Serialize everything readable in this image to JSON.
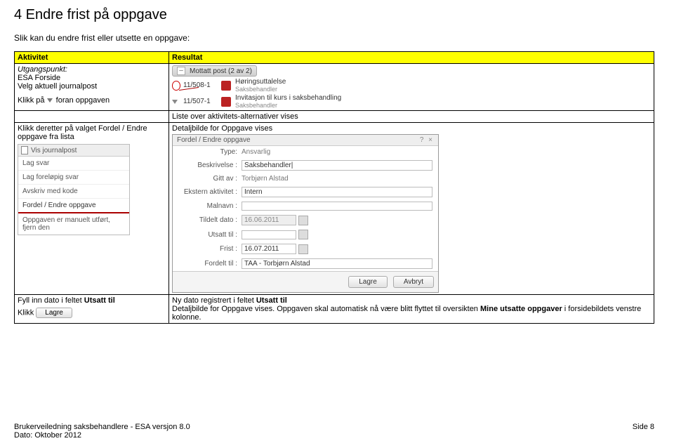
{
  "heading": "4    Endre frist på oppgave",
  "subheading": "Slik kan du endre frist eller utsette en oppgave:",
  "table": {
    "header_a": "Aktivitet",
    "header_b": "Resultat",
    "row1a_line1": "Utgangspunkt:",
    "row1a_line2": "ESA Forside",
    "row1a_line3": "Velg aktuell journalpost",
    "row1a_line5": "Klikk på ",
    "row1a_line5b": " foran oppgaven",
    "mottatt": "Mottatt post (2 av 2)",
    "jp": [
      {
        "id": "11/508-1",
        "title": "Høringsuttalelse",
        "sub": "Saksbehandler"
      },
      {
        "id": "11/507-1",
        "title": "Invitasjon til kurs i saksbehandling",
        "sub": "Saksbehandler"
      }
    ],
    "row2b": "Liste over aktivitets-alternativer vises",
    "row3a_line1": "Klikk deretter på valget Fordel / Endre",
    "row3a_line2": "oppgave fra lista",
    "row3b": "Detaljbilde for Oppgave vises",
    "menu": {
      "title": "Vis journalpost",
      "items": [
        "Lag svar",
        "Lag foreløpig svar",
        "Avskriv med kode"
      ],
      "highlight": "Fordel / Endre oppgave",
      "last": "Oppgaven er manuelt utført, fjern den"
    },
    "dialog": {
      "title": "Fordel / Endre oppgave",
      "fields": {
        "type": "Type:",
        "type_v": "Ansvarlig",
        "beskrivelse": "Beskrivelse :",
        "beskrivelse_v": "Saksbehandler|",
        "gitt": "Gitt av :",
        "gitt_v": "Torbjørn Alstad",
        "ekstern": "Ekstern aktivitet :",
        "ekstern_v": "Intern",
        "malnavn": "Malnavn :",
        "tildelt": "Tildelt dato :",
        "tildelt_v": "16.06.2011",
        "utsatt": "Utsatt til :",
        "frist": "Frist :",
        "frist_v": "16.07.2011",
        "fordelt": "Fordelt til :",
        "fordelt_v": "TAA - Torbjørn Alstad"
      },
      "lagre": "Lagre",
      "avbryt": "Avbryt"
    },
    "row4a_line1": "Fyll inn dato i feltet Utsatt til",
    "row4a_line2": "Klikk",
    "row4a_btn": "Lagre",
    "row4b_line1": "Ny dato registrert i feltet Utsatt til",
    "row4b_line2a": "Detaljbilde for Oppgave vises. Oppgaven skal automatisk nå være blitt flyttet til oversikten ",
    "row4b_line2b": "Mine utsatte oppgaver",
    "row4b_line2c": " i forsidebildets venstre kolonne."
  },
  "footer": {
    "left1": "Brukerveiledning saksbehandlere - ESA versjon 8.0",
    "left2": "Dato: Oktober 2012",
    "right": "Side 8"
  }
}
